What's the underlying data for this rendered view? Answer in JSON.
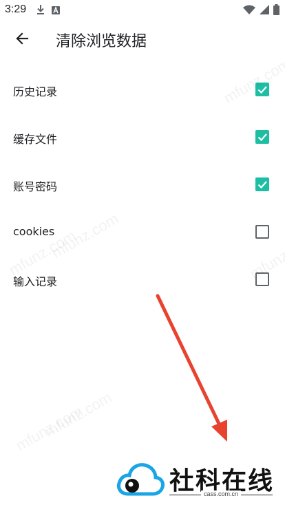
{
  "status_bar": {
    "time": "3:29",
    "left_icons": [
      "download-icon",
      "font-a-icon"
    ],
    "right_icons": [
      "wifi-icon",
      "cell-signal-icon",
      "battery-icon"
    ]
  },
  "toolbar": {
    "back_icon": "arrow-left-icon",
    "title": "清除浏览数据"
  },
  "items": [
    {
      "label": "历史记录",
      "checked": true
    },
    {
      "label": "缓存文件",
      "checked": true
    },
    {
      "label": "账号密码",
      "checked": true
    },
    {
      "label": "cookies",
      "checked": false
    },
    {
      "label": "输入记录",
      "checked": false
    }
  ],
  "watermark": "mfunz.com",
  "annotation": {
    "color": "#e8432f"
  },
  "brand": {
    "name": "社科在线",
    "domain": "cass.com.cn",
    "logo_colors": [
      "#1aa6e4",
      "#111111"
    ]
  },
  "colors": {
    "checkbox_on": "#1ebea5",
    "checkbox_off_border": "#5f6368",
    "text": "#202124"
  }
}
